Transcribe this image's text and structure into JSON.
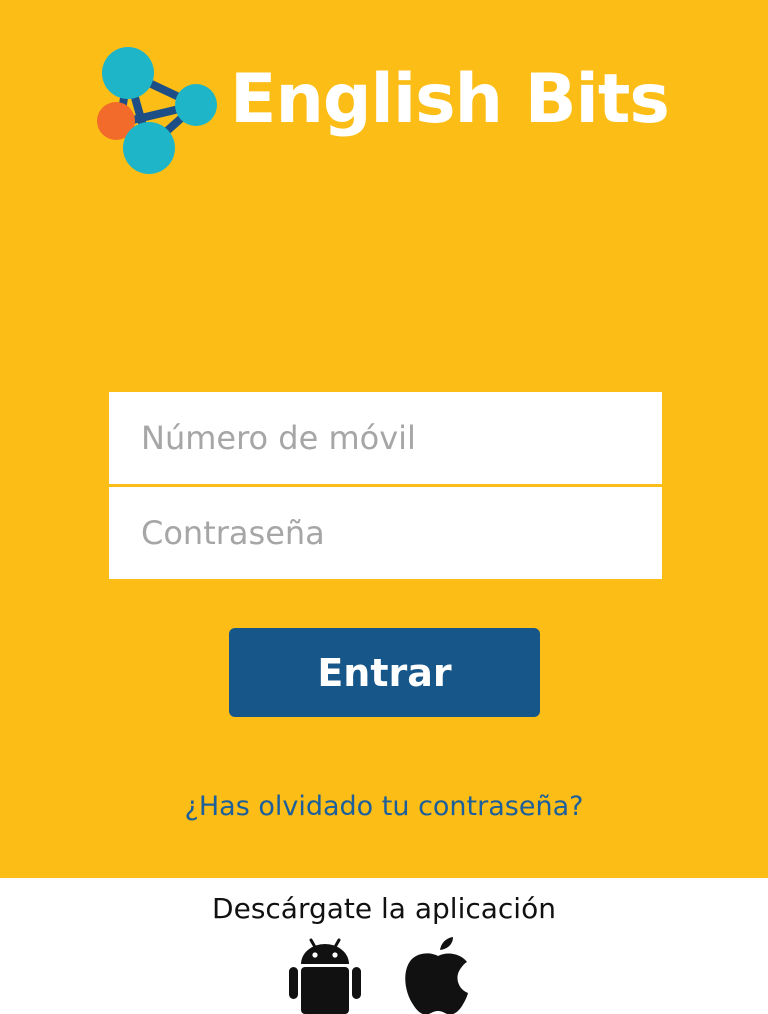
{
  "brand": {
    "name": "English Bits",
    "colors": {
      "background": "#fbbd16",
      "brand_text": "#ffffff",
      "node": "#1eb5c9",
      "node_accent": "#f26b2a",
      "connector": "#1d4f86"
    }
  },
  "login": {
    "phone_placeholder": "Número de móvil",
    "password_placeholder": "Contraseña",
    "submit_label": "Entrar",
    "submit_color": "#175689",
    "forgot_password": "¿Has olvidado tu contraseña?"
  },
  "download": {
    "title": "Descárgate la aplicación",
    "stores": [
      {
        "name": "android",
        "icon": "android-icon"
      },
      {
        "name": "ios",
        "icon": "apple-icon"
      }
    ]
  }
}
